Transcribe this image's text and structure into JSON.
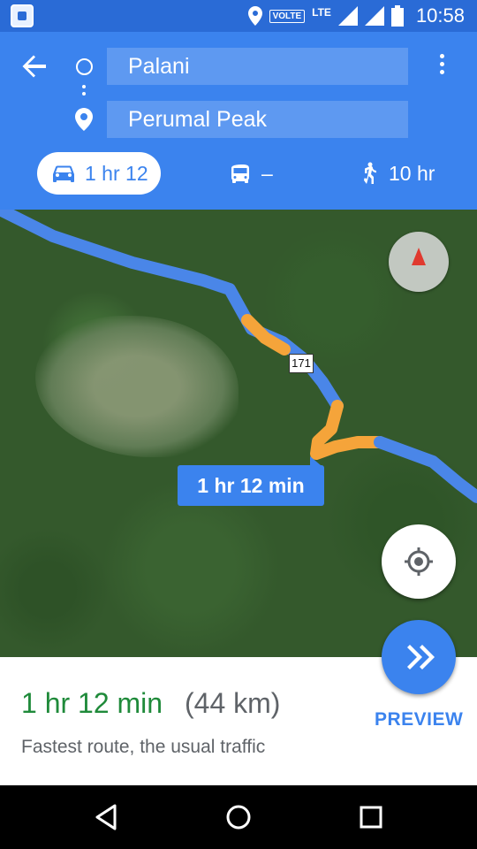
{
  "status_bar": {
    "network_badge": "VOLTE",
    "network_type": "LTE",
    "time": "10:58"
  },
  "header": {
    "origin": "Palani",
    "destination": "Perumal Peak",
    "modes": {
      "drive": {
        "label": "1 hr 12",
        "icon": "car-icon",
        "selected": true
      },
      "transit": {
        "label": "–",
        "icon": "bus-icon"
      },
      "walk": {
        "label": "10 hr",
        "icon": "walking-person-icon"
      }
    }
  },
  "map": {
    "road_number": "171",
    "route_time_bubble": "1 hr 12 min",
    "route_color": "#4a86e8",
    "traffic_color": "#f5a43a"
  },
  "sheet": {
    "duration": "1 hr 12 min",
    "distance": "(44 km)",
    "description": "Fastest route, the usual traffic",
    "preview_label": "PREVIEW"
  },
  "colors": {
    "accent": "#3b83ee",
    "duration_green": "#1f8a3a"
  }
}
